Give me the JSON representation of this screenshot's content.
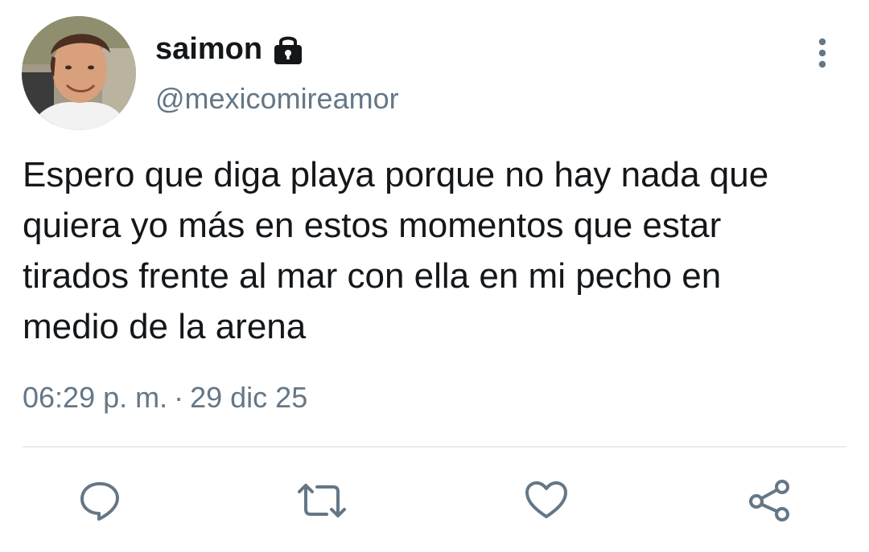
{
  "user": {
    "display_name": "saimon",
    "handle": "@mexicomireamor",
    "protected_icon": "lock-icon",
    "avatar_icon": "profile-photo"
  },
  "tweet": {
    "text": "Espero que diga playa porque no hay nada que\nquiera yo más en estos momentos que estar\ntirados frente al mar con ella en mi pecho en\nmedio de la arena",
    "time": "06:29 p. m.",
    "separator": "·",
    "date": "29 dic 25"
  },
  "actions": [
    {
      "name": "reply",
      "icon": "reply-icon"
    },
    {
      "name": "retweet",
      "icon": "retweet-icon"
    },
    {
      "name": "like",
      "icon": "heart-icon"
    },
    {
      "name": "share",
      "icon": "share-icon"
    }
  ],
  "menu": {
    "icon": "more-vertical-icon"
  },
  "colors": {
    "text": "#14171a",
    "secondary": "#657786",
    "icon": "#657786",
    "divider": "#e6ecf0",
    "background": "#ffffff"
  }
}
